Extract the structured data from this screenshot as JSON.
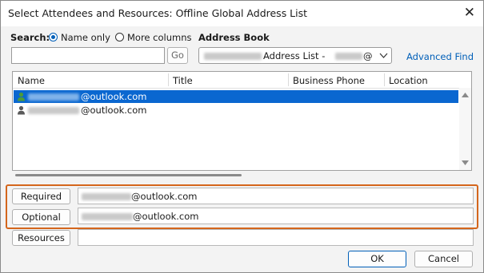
{
  "dialog": {
    "title": "Select Attendees and Resources: Offline Global Address List",
    "close_glyph": "✕"
  },
  "search": {
    "label": "Search:",
    "option_name_only": "Name only",
    "option_more_columns": "More columns",
    "selected_option": "Name only",
    "input_value": "",
    "go_label": "Go"
  },
  "address_book": {
    "label": "Address Book",
    "selected_visible": "Address List -",
    "selected_suffix": "@",
    "advanced_find_label": "Advanced Find"
  },
  "list": {
    "columns": [
      "Name",
      "Title",
      "Business Phone",
      "Location"
    ],
    "rows": [
      {
        "name_suffix": "@outlook.com",
        "selected": true
      },
      {
        "name_suffix": "@outlook.com",
        "selected": false
      }
    ]
  },
  "recipients": {
    "required_label": "Required",
    "required_suffix": "@outlook.com",
    "optional_label": "Optional",
    "optional_suffix": "@outlook.com",
    "resources_label": "Resources",
    "resources_value": ""
  },
  "buttons": {
    "ok_label": "OK",
    "cancel_label": "Cancel"
  },
  "colors": {
    "accent": "#005fb8",
    "selection": "#0a67d0",
    "highlight_border": "#d4661c"
  },
  "icons": [
    "close-icon",
    "person-icon",
    "chevron-down-icon",
    "scroll-up-arrow-icon",
    "scroll-down-arrow-icon"
  ]
}
